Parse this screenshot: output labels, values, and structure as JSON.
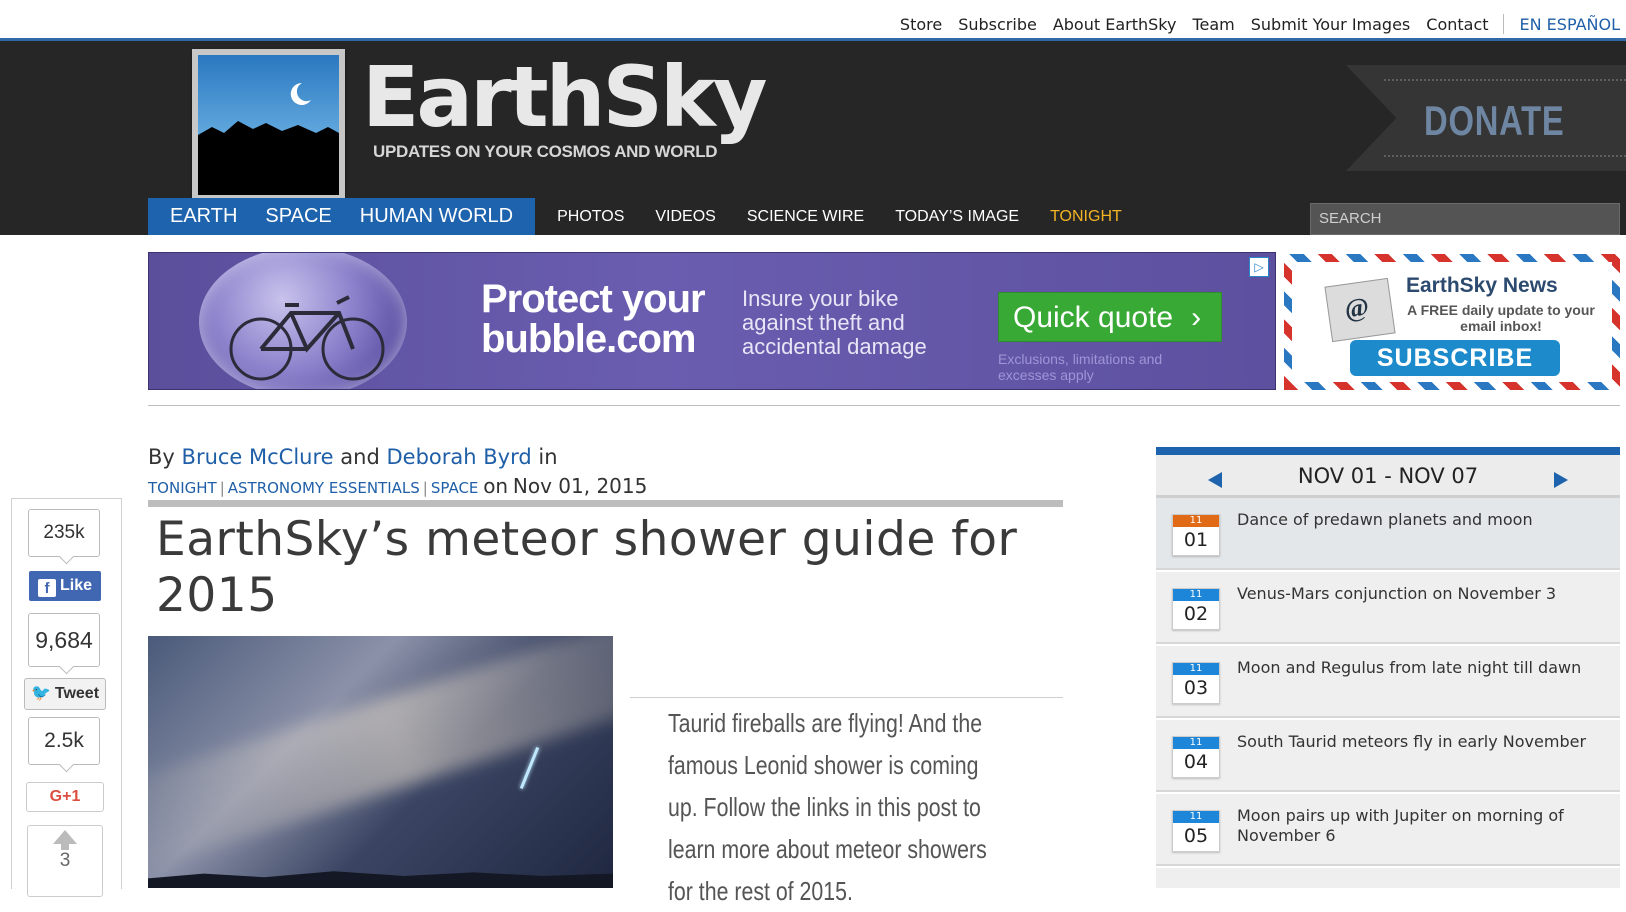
{
  "top_links": [
    "Store",
    "Subscribe",
    "About EarthSky",
    "Team",
    "Submit Your Images",
    "Contact"
  ],
  "top_lang_link": "EN ESPAÑOL",
  "brand": {
    "name": "EarthSky",
    "tagline": "UPDATES ON YOUR COSMOS AND WORLD",
    "donate": "DONATE"
  },
  "nav": {
    "primary": [
      "EARTH",
      "SPACE",
      "HUMAN WORLD"
    ],
    "secondary": [
      "PHOTOS",
      "VIDEOS",
      "SCIENCE WIRE",
      "TODAY’S IMAGE"
    ],
    "highlight": "TONIGHT",
    "search_placeholder": "SEARCH"
  },
  "ad": {
    "headline_1": "Protect your",
    "headline_2": "bubble",
    "headline_3": ".com",
    "sub": "Insure your bike against theft and accidental damage",
    "button": "Quick quote",
    "fine_print": "Exclusions, limitations and excesses apply",
    "choice_icon": "ad-choices-icon"
  },
  "subscribe_ad": {
    "title": "EarthSky News",
    "line": "A FREE daily update to your email inbox!",
    "button": "SUBSCRIBE"
  },
  "article": {
    "by": "By",
    "author_1": "Bruce McClure",
    "and": "and",
    "author_2": "Deborah Byrd",
    "in": "in",
    "categories": [
      "TONIGHT",
      "ASTRONOMY ESSENTIALS",
      "SPACE"
    ],
    "date_prefix": "on",
    "date": "Nov 01, 2015",
    "title": "EarthSky’s meteor shower guide for 2015",
    "excerpt": "Taurid fireballs are flying! And the famous Leonid shower is coming up. Follow the links in this post to learn more about meteor showers for the rest of 2015."
  },
  "share": {
    "facebook_count": "235k",
    "facebook_label": "Like",
    "twitter_count": "9,684",
    "twitter_label": "Tweet",
    "gplus_count": "2.5k",
    "gplus_label": "G+1",
    "upvote_count": "3"
  },
  "sidebar": {
    "range": "NOV 01 - NOV 07",
    "items": [
      {
        "month": "11",
        "day": "01",
        "text": "Dance of predawn planets and moon"
      },
      {
        "month": "11",
        "day": "02",
        "text": "Venus-Mars conjunction on November 3"
      },
      {
        "month": "11",
        "day": "03",
        "text": "Moon and Regulus from late night till dawn"
      },
      {
        "month": "11",
        "day": "04",
        "text": "South Taurid meteors fly in early November"
      },
      {
        "month": "11",
        "day": "05",
        "text": "Moon pairs up with Jupiter on morning of November 6"
      }
    ]
  },
  "colors": {
    "brand_blue": "#1e63ad",
    "header_bg": "#262626",
    "tonight": "#f4b423"
  }
}
